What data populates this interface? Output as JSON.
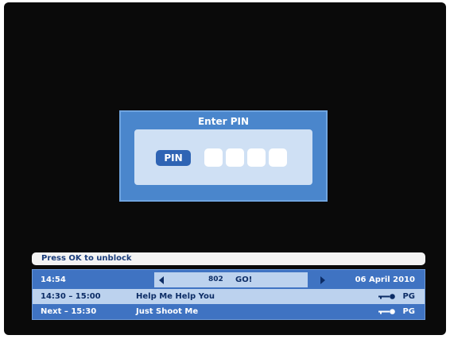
{
  "pin_dialog": {
    "title": "Enter PIN",
    "label": "PIN",
    "digit_count": 4
  },
  "message": "Press OK to unblock",
  "info": {
    "clock": "14:54",
    "channel_number": "802",
    "channel_name": "GO!",
    "date": "06 April 2010",
    "now": {
      "time": "14:30 – 15:00",
      "title": "Help Me Help You",
      "rating": "PG",
      "icon": "key-icon"
    },
    "next": {
      "time": "Next – 15:30",
      "title": "Just Shoot Me",
      "rating": "PG",
      "icon": "key-icon"
    }
  },
  "colors": {
    "background": "#0a0a0a",
    "dialog": "#4a86cc",
    "panel": "#3f73c2",
    "highlight": "#bcd2ee"
  }
}
